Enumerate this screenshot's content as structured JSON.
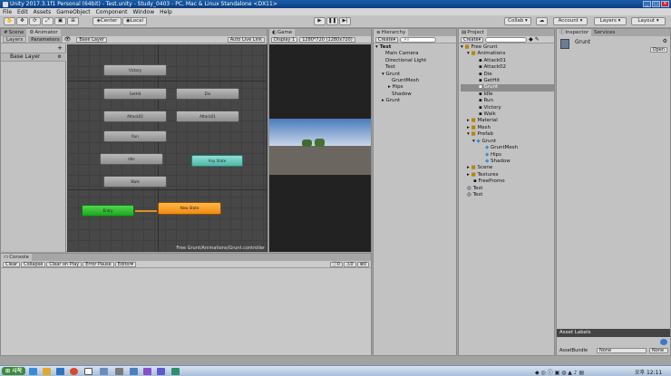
{
  "window": {
    "title": "Unity 2017.3.1f1 Personal (64bit) - Test.unity - Study_0403 - PC, Mac & Linux Standalone <DX11>"
  },
  "menu": [
    "File",
    "Edit",
    "Assets",
    "GameObject",
    "Component",
    "Window",
    "Help"
  ],
  "toolbar": {
    "pivot": "Center",
    "space": "Local",
    "collab": "Collab",
    "account": "Account",
    "layers": "Layers",
    "layout": "Layout"
  },
  "scene_tab": "Scene",
  "animator": {
    "tab": "Animator",
    "layers_tab": "Layers",
    "parameters_tab": "Parameters",
    "breadcrumb": "Base Layer",
    "auto_live_link": "Auto Live Link",
    "layer_name": "Base Layer",
    "path": "Free Grunt/Animations/Grunt.controller",
    "states": {
      "victory": "Victory",
      "getHit": "GetHit",
      "die": "Die",
      "attack02": "Attack02",
      "attack01": "Attack01",
      "run": "Run",
      "idle": "Idle",
      "anyState": "Any State",
      "walk": "Walk",
      "entry": "Entry",
      "newState": "New State"
    }
  },
  "game": {
    "tab": "Game",
    "display": "Display 1",
    "resolution": "1280*720 (1280x720)"
  },
  "hierarchy": {
    "tab": "Hierarchy",
    "create": "Create",
    "search": "All",
    "scene": "Test",
    "items": [
      "Main Camera",
      "Directional Light",
      "Test",
      "Grunt",
      "GruntMesh",
      "Hips",
      "Shadow",
      "Grunt"
    ]
  },
  "project": {
    "tab": "Project",
    "create": "Create",
    "items": [
      "Free Grunt",
      "Animations",
      "Attack01",
      "Attack02",
      "Die",
      "GetHit",
      "Grunt",
      "Idle",
      "Run",
      "Victory",
      "Walk",
      "Material",
      "Mesh",
      "Prefab",
      "Grunt",
      "GruntMesh",
      "Hips",
      "Shadow",
      "Scene",
      "Textures",
      "FreePromo",
      "Test",
      "Test"
    ]
  },
  "inspector": {
    "tab": "Inspector",
    "services_tab": "Services",
    "name": "Grunt",
    "open": "Open",
    "asset_labels": "Asset Labels",
    "asset_bundle": "AssetBundle",
    "none1": "None",
    "none2": "None"
  },
  "console": {
    "tab": "Console",
    "clear": "Clear",
    "collapse": "Collapse",
    "clear_on_play": "Clear on Play",
    "error_pause": "Error Pause",
    "editor": "Editor",
    "c1": "0",
    "c2": "0",
    "c3": "0"
  },
  "taskbar": {
    "start": "시작",
    "clock": "오후 12:11"
  }
}
